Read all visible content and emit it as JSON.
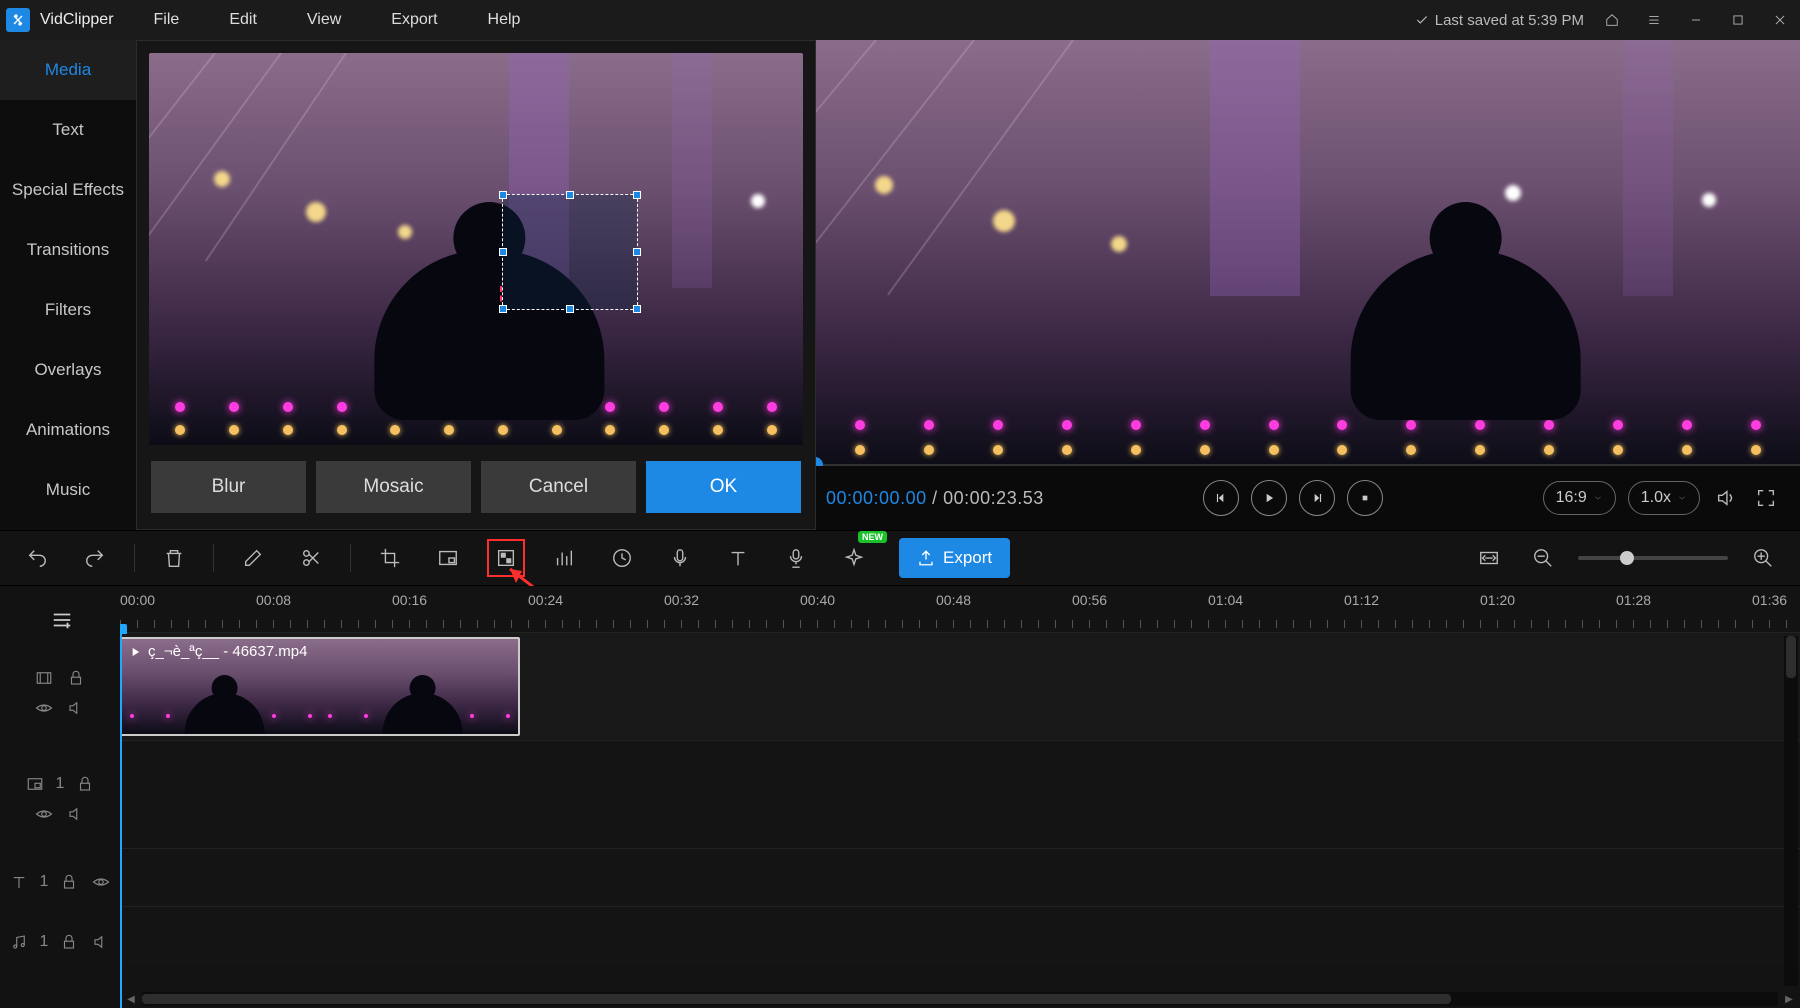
{
  "titlebar": {
    "app_name": "VidClipper",
    "saved_text": "Last saved at 5:39 PM"
  },
  "menubar": {
    "file": "File",
    "edit": "Edit",
    "view": "View",
    "export": "Export",
    "help": "Help"
  },
  "side_tabs": {
    "media": "Media",
    "text": "Text",
    "special_effects": "Special Effects",
    "transitions": "Transitions",
    "filters": "Filters",
    "overlays": "Overlays",
    "animations": "Animations",
    "music": "Music"
  },
  "dialog": {
    "blur": "Blur",
    "mosaic": "Mosaic",
    "cancel": "Cancel",
    "ok": "OK"
  },
  "player": {
    "current_time": "00:00:00.00",
    "separator": "/",
    "duration": "00:00:23.53",
    "aspect_ratio": "16:9",
    "speed": "1.0x"
  },
  "toolbar": {
    "export": "Export",
    "new_badge": "NEW"
  },
  "timeline": {
    "ticks": [
      "00:00",
      "00:08",
      "00:16",
      "00:24",
      "00:32",
      "00:40",
      "00:48",
      "00:56",
      "01:04",
      "01:12",
      "01:20",
      "01:28",
      "01:36"
    ],
    "clip_name": "ç_¬è_ªç__ - 46637.mp4",
    "pip_track_index": "1",
    "text_track_index": "1",
    "audio_track_index": "1"
  }
}
